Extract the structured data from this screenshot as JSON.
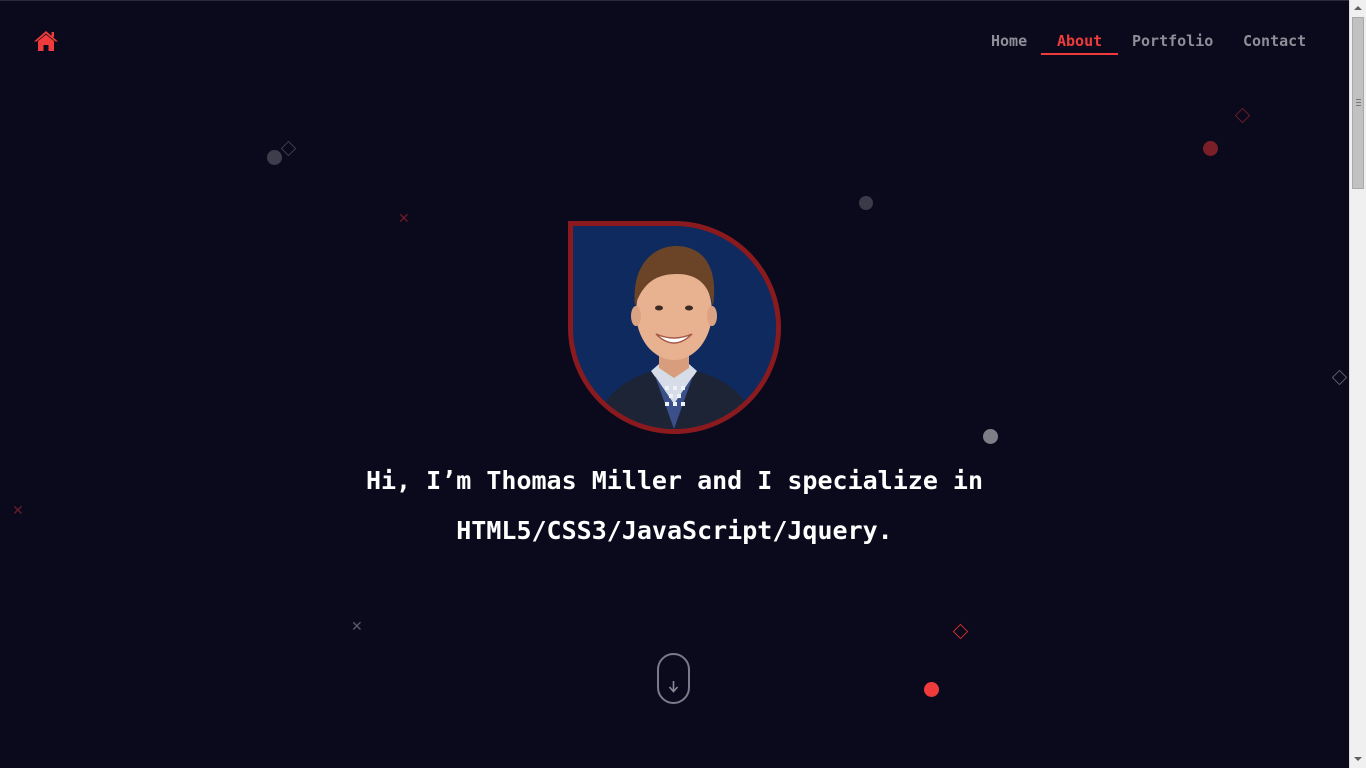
{
  "header": {
    "home_icon": "home-icon",
    "nav": [
      {
        "label": "Home",
        "active": false
      },
      {
        "label": "About",
        "active": true
      },
      {
        "label": "Portfolio",
        "active": false
      },
      {
        "label": "Contact",
        "active": false
      }
    ]
  },
  "hero": {
    "avatar_alt": "Thomas Miller",
    "line1": "Hi, I’m Thomas Miller and I specialize in",
    "line2": "HTML5/CSS3/JavaScript/Jquery."
  },
  "scroll_icon": "arrow-down-icon",
  "colors": {
    "background": "#0a0a1c",
    "accent": "#ef3b3b",
    "avatar_border": "#8b1a1f",
    "nav_text": "#8e8e98",
    "hero_text": "#ffffff"
  }
}
